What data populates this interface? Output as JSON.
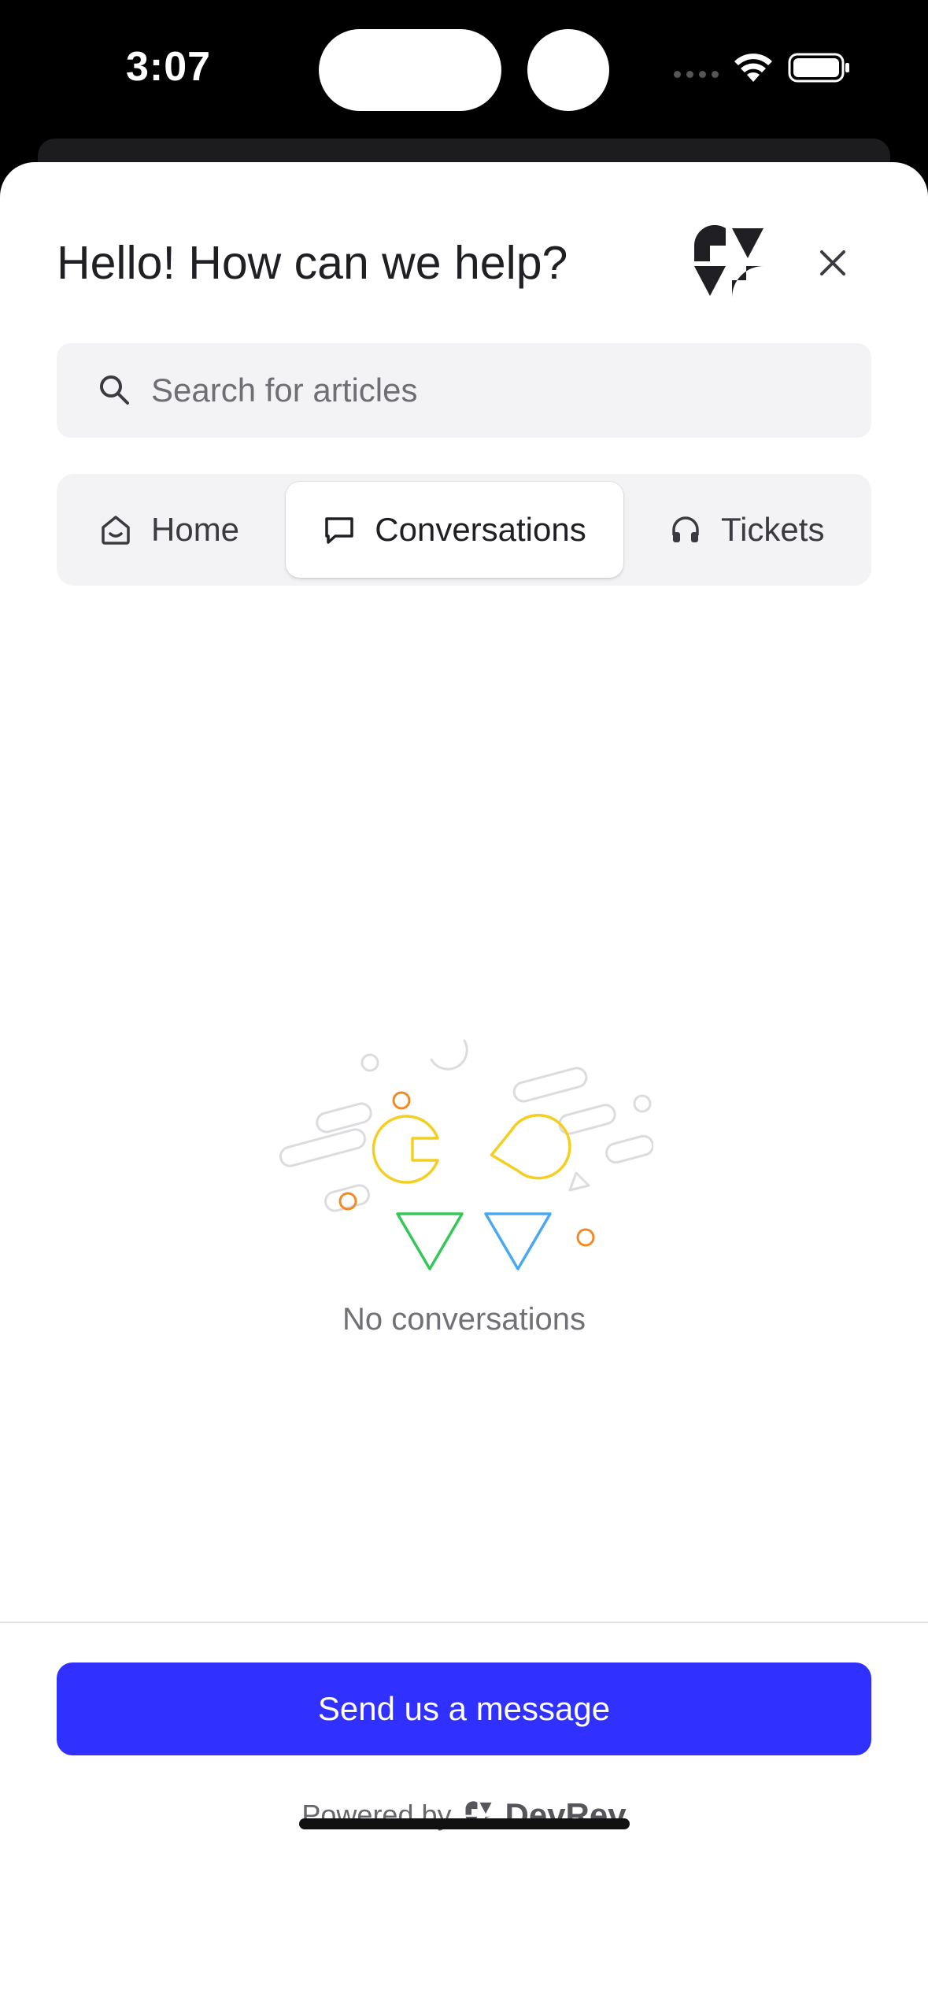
{
  "status_bar": {
    "time": "3:07"
  },
  "header": {
    "greeting": "Hello! How can we help?",
    "logo_icon": "devrey-logo-icon",
    "close_icon": "close-icon"
  },
  "search": {
    "placeholder": "Search for articles",
    "value": ""
  },
  "tabs": [
    {
      "label": "Home",
      "icon": "home-icon",
      "selected": false
    },
    {
      "label": "Conversations",
      "icon": "chat-bubble-icon",
      "selected": true
    },
    {
      "label": "Tickets",
      "icon": "headphones-icon",
      "selected": false
    }
  ],
  "empty_state": {
    "message": "No conversations"
  },
  "footer": {
    "send_label": "Send us a message",
    "powered_prefix": "Powered by",
    "powered_brand": "DevRev"
  },
  "colors": {
    "accent": "#3030ff",
    "illustration_yellow": "#f4cf22",
    "illustration_green": "#34c759",
    "illustration_blue": "#4aa8f0",
    "illustration_orange": "#f08a24"
  }
}
